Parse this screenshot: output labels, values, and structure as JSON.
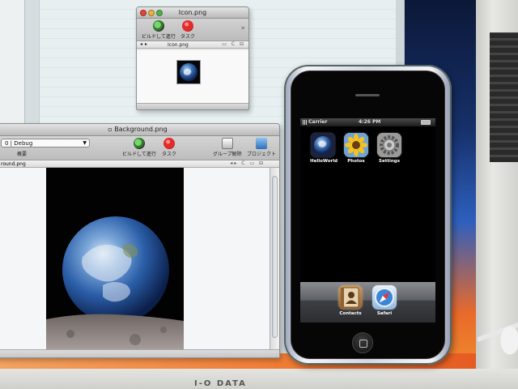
{
  "icon_window": {
    "title": "Icon.png",
    "toolbar_build_label": "ビルドして進行",
    "toolbar_task_label": "タスク",
    "path_filename": "Icon.png"
  },
  "background_window": {
    "title": "Background.png",
    "config_value": "0 | Debug",
    "overview_label": "概要",
    "toolbar_build_label": "ビルドして進行",
    "toolbar_task_label": "タスク",
    "toolbar_ungroup_label": "グループ解除",
    "toolbar_project_label": "プロジェクト",
    "path_filename": "round.png"
  },
  "iphone": {
    "carrier": "Carrier",
    "time": "4:26 PM",
    "apps": [
      {
        "label": "HelloWorld",
        "icon": "earth-icon"
      },
      {
        "label": "Photos",
        "icon": "sunflower-icon"
      },
      {
        "label": "Settings",
        "icon": "gear-icon"
      }
    ],
    "dock": [
      {
        "label": "Contacts",
        "icon": "contacts-icon"
      },
      {
        "label": "Safari",
        "icon": "compass-icon"
      }
    ]
  },
  "monitor": {
    "brand": "I-O DATA"
  }
}
